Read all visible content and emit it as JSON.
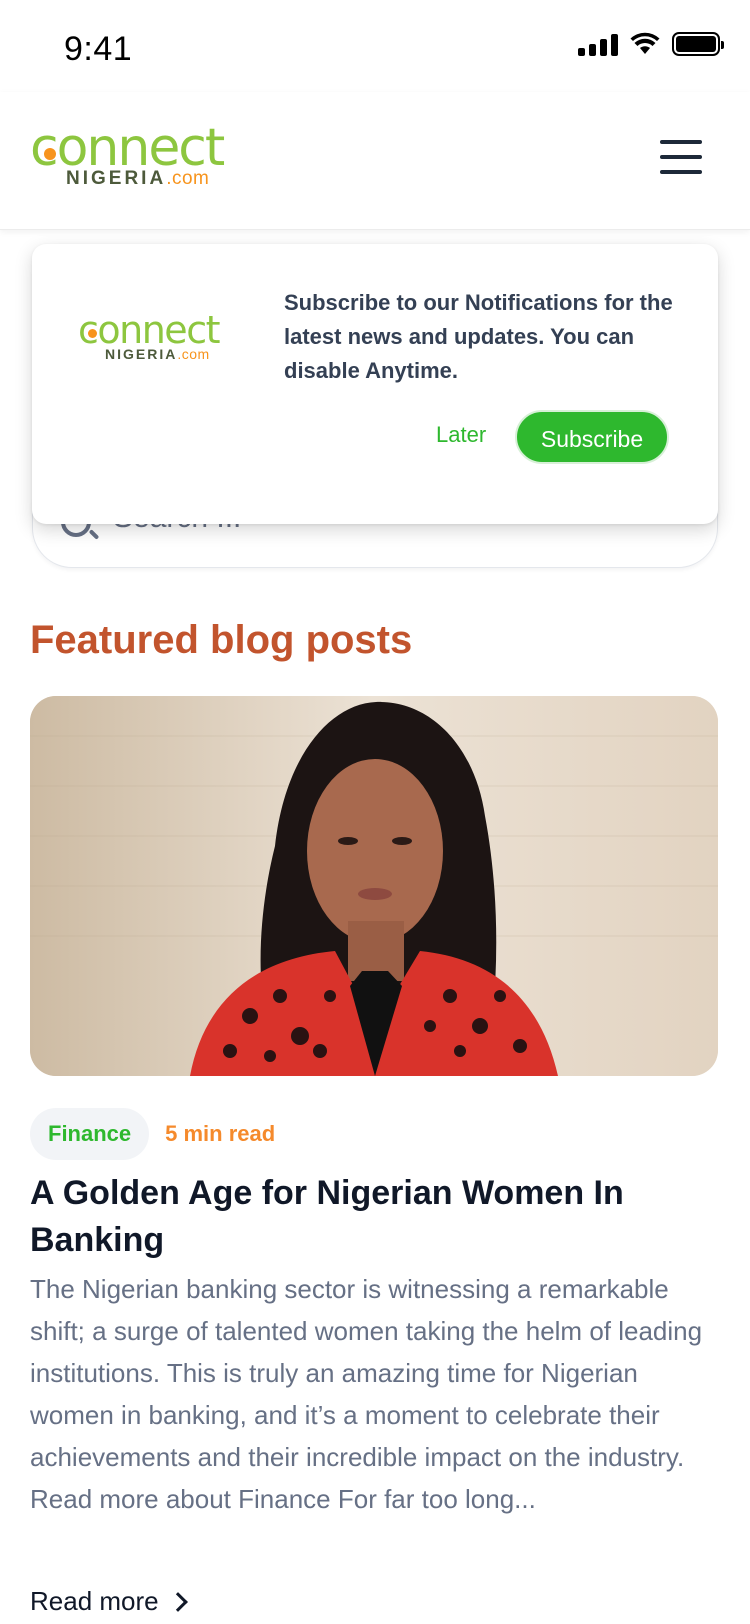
{
  "status_bar": {
    "time": "9:41",
    "icons": [
      "signal-icon",
      "wifi-icon",
      "battery-icon"
    ]
  },
  "header": {
    "logo_word": "connect",
    "logo_sub": "NIGERIA",
    "logo_com": ".com",
    "menu_icon": "hamburger-menu-icon"
  },
  "popup": {
    "logo_word": "connect",
    "logo_sub": "NIGERIA",
    "logo_com": ".com",
    "message": "Subscribe to our Notifications for the latest news and updates. You can disable Anytime.",
    "later_label": "Later",
    "subscribe_label": "Subscribe"
  },
  "search": {
    "placeholder": "Search ..."
  },
  "featured": {
    "title": "Featured blog posts",
    "post": {
      "category": "Finance",
      "read_time": "5 min read",
      "title": "A Golden Age for Nigerian Women In Banking",
      "excerpt": "The Nigerian banking sector is witnessing a remarkable shift; a surge of talented women taking the helm of leading institutions. This is truly an amazing time for Nigerian women in banking, and it’s a moment to celebrate their achievements and their incredible impact on the industry. Read more about Finance For far too long...",
      "read_more": "Read more"
    }
  },
  "colors": {
    "brand_green": "#8dc63f",
    "button_green": "#2eb82e",
    "heading_orange": "#c2542d",
    "read_time_orange": "#f58a2c"
  }
}
